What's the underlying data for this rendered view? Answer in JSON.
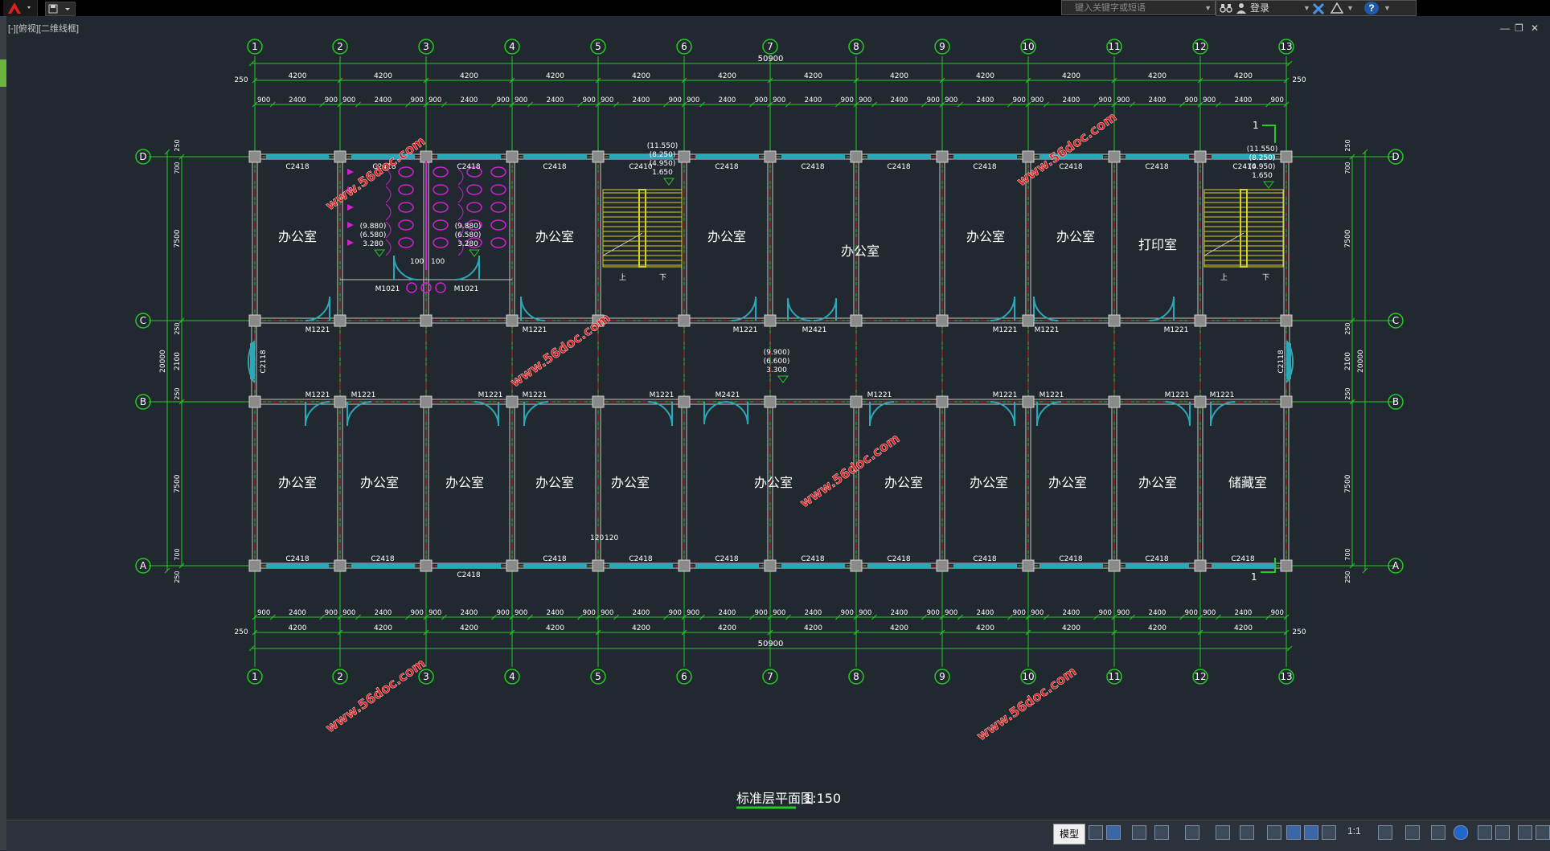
{
  "app": {
    "view_label": "[-][俯视][二维线框]",
    "search_placeholder": "键入关键字或短语",
    "login_label": "登录",
    "help_label": "?",
    "window_controls": [
      "—",
      "❐",
      "✕"
    ]
  },
  "drawing": {
    "title": "标准层平面图",
    "scale": "1:150",
    "axes_numbers": [
      "1",
      "2",
      "3",
      "4",
      "5",
      "6",
      "7",
      "8",
      "9",
      "10",
      "11",
      "12",
      "13"
    ],
    "axes_letters": [
      "D",
      "C",
      "B",
      "A"
    ],
    "total_length": "50900",
    "end_offset": "250",
    "bay": "4200",
    "sub_dims": [
      "900",
      "2400",
      "900"
    ],
    "half_120": "120",
    "depth_total": "20000",
    "depth_dims": [
      "7500",
      "2100",
      "7500"
    ],
    "small_dims": [
      "250",
      "700",
      "250"
    ],
    "watermark": "www.56doc.com",
    "room_office": "办公室",
    "room_print": "打印室",
    "room_storage": "储藏室",
    "window_c2418": "C2418",
    "window_c2410": "C2410",
    "window_c2118": "C2118",
    "door_m1221": "M1221",
    "door_m2421": "M2421",
    "door_m1021": "M1021",
    "elev_stair": [
      "(11.550)",
      "(8.250)",
      "(4.950)",
      "1.650"
    ],
    "elev_toilet": [
      "(9.880)",
      "(6.580)",
      "3.280"
    ],
    "elev_corridor": [
      "(9.900)",
      "(6.600)",
      "3.300"
    ],
    "stair_up": "上",
    "stair_down": "下",
    "section_mark": "1",
    "dim_100": "100"
  },
  "statusbar": {
    "model_label": "模型",
    "annotation_scale": "1:1"
  },
  "colors": {
    "background": "#212830",
    "axis_green": "#22cc22",
    "axis_red": "#cc2222",
    "wall": "#c8c8c8",
    "window_cyan": "#2aa8b8",
    "fixture_magenta": "#d020d0",
    "stair_yellow": "#d8d020",
    "watermark_red": "#e02020",
    "text": "#ffffff"
  }
}
